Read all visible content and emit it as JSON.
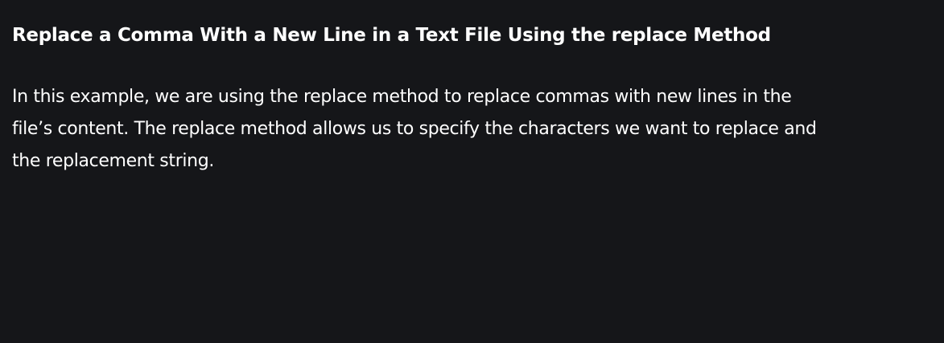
{
  "article": {
    "heading": "Replace a Comma With a New Line in a Text File Using the replace Method",
    "paragraph": "In this example, we are using the replace method to replace commas with new lines in the file’s content. The replace method allows us to specify the characters we want to replace and the replacement string."
  },
  "colors": {
    "background": "#151619",
    "text": "#ffffff"
  }
}
